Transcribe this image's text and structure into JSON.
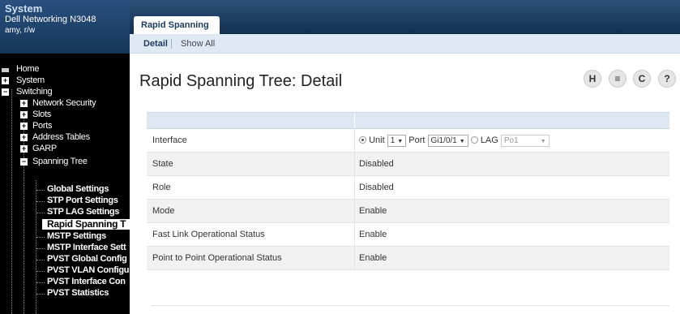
{
  "system": {
    "title": "System",
    "model": "Dell Networking N3048",
    "user": "amy, r/w"
  },
  "tree": {
    "home": "Home",
    "system": "System",
    "switching": "Switching",
    "network_security": "Network Security",
    "slots": "Slots",
    "ports": "Ports",
    "address_tables": "Address Tables",
    "garp": "GARP",
    "spanning_tree": "Spanning Tree",
    "global_settings": "Global Settings",
    "stp_port_settings": "STP Port Settings",
    "stp_lag_settings": "STP LAG Settings",
    "rapid_spanning": "Rapid Spanning T",
    "mstp_settings": "MSTP Settings",
    "mstp_interface": "MSTP Interface Sett",
    "pvst_global": "PVST Global Config",
    "pvst_vlan": "PVST VLAN Configu",
    "pvst_interface": "PVST Interface Con",
    "pvst_statistics": "PVST Statistics"
  },
  "tab": {
    "label": "Rapid Spanning Tree"
  },
  "subnav": {
    "detail": "Detail",
    "show_all": "Show All"
  },
  "page": {
    "title": "Rapid Spanning Tree: Detail"
  },
  "tools": {
    "save": "H",
    "print": "≡",
    "refresh": "C",
    "help": "?"
  },
  "interface": {
    "label": "Interface",
    "unit_label": "Unit",
    "unit_value": "1",
    "port_label": "Port",
    "port_value": "Gi1/0/1",
    "lag_label": "LAG",
    "lag_value": "Po1"
  },
  "rows": [
    {
      "label": "State",
      "value": "Disabled"
    },
    {
      "label": "Role",
      "value": "Disabled"
    },
    {
      "label": "Mode",
      "value": "Enable"
    },
    {
      "label": "Fast Link Operational Status",
      "value": "Enable"
    },
    {
      "label": "Point to Point Operational Status",
      "value": "Enable"
    }
  ]
}
